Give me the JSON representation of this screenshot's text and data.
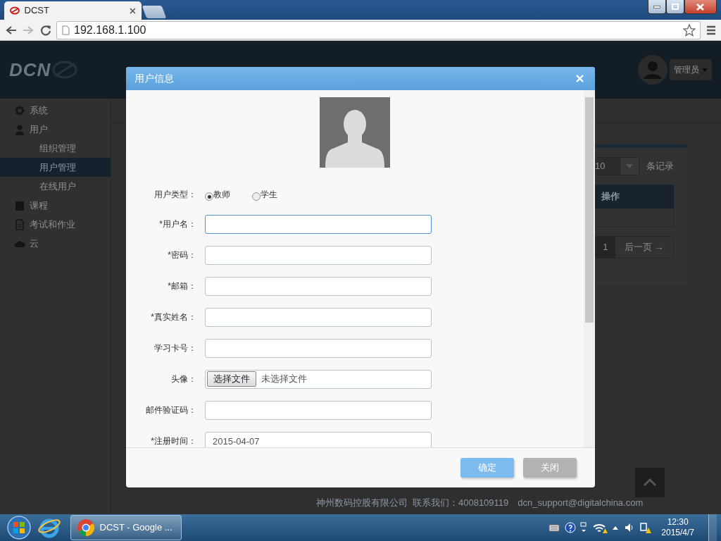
{
  "browser": {
    "tab": {
      "title": "DCST"
    },
    "address": "192.168.1.100"
  },
  "header": {
    "logo": "DCN",
    "user": "管理员"
  },
  "sidebar": {
    "items": [
      {
        "label": "系统"
      },
      {
        "label": "用户",
        "children": [
          {
            "label": "组织管理",
            "selected": false
          },
          {
            "label": "用户管理",
            "selected": true
          },
          {
            "label": "在线用户",
            "selected": false
          }
        ]
      },
      {
        "label": "课程"
      },
      {
        "label": "考试和作业"
      },
      {
        "label": "云"
      }
    ]
  },
  "content": {
    "page_size": "10",
    "page_size_suffix": "条记录",
    "table_header": "操作",
    "pagination": {
      "current": "1",
      "next": "后一页 →"
    }
  },
  "footer": {
    "company": "神州数码控股有限公司",
    "contact": "联系我们：4008109119",
    "email": "dcn_support@digitalchina.com"
  },
  "dialog": {
    "title": "用户信息",
    "user_type": {
      "label": "用户类型：",
      "options": [
        {
          "label": "教师",
          "selected": true
        },
        {
          "label": "学生",
          "selected": false
        }
      ]
    },
    "fields": [
      {
        "label": "*用户名：",
        "kind": "text",
        "focused": true
      },
      {
        "label": "*密码：",
        "kind": "text",
        "focused": false
      },
      {
        "label": "*邮箱：",
        "kind": "text",
        "focused": false
      },
      {
        "label": "*真实姓名：",
        "kind": "text",
        "focused": false
      },
      {
        "label": "学习卡号：",
        "kind": "text",
        "focused": false
      },
      {
        "label": "头像：",
        "kind": "file",
        "button": "选择文件",
        "status": "未选择文件"
      },
      {
        "label": "邮件验证码：",
        "kind": "text",
        "focused": false
      },
      {
        "label": "*注册时间：",
        "kind": "text",
        "focused": false,
        "value": "2015-04-07"
      }
    ],
    "buttons": [
      {
        "label": "确定",
        "kind": "primary"
      },
      {
        "label": "关闭",
        "kind": "secondary"
      }
    ]
  },
  "taskbar": {
    "tasks": [
      {
        "label": "DCST - Google ..."
      }
    ],
    "time": "12:30",
    "date": "2015/4/7"
  }
}
